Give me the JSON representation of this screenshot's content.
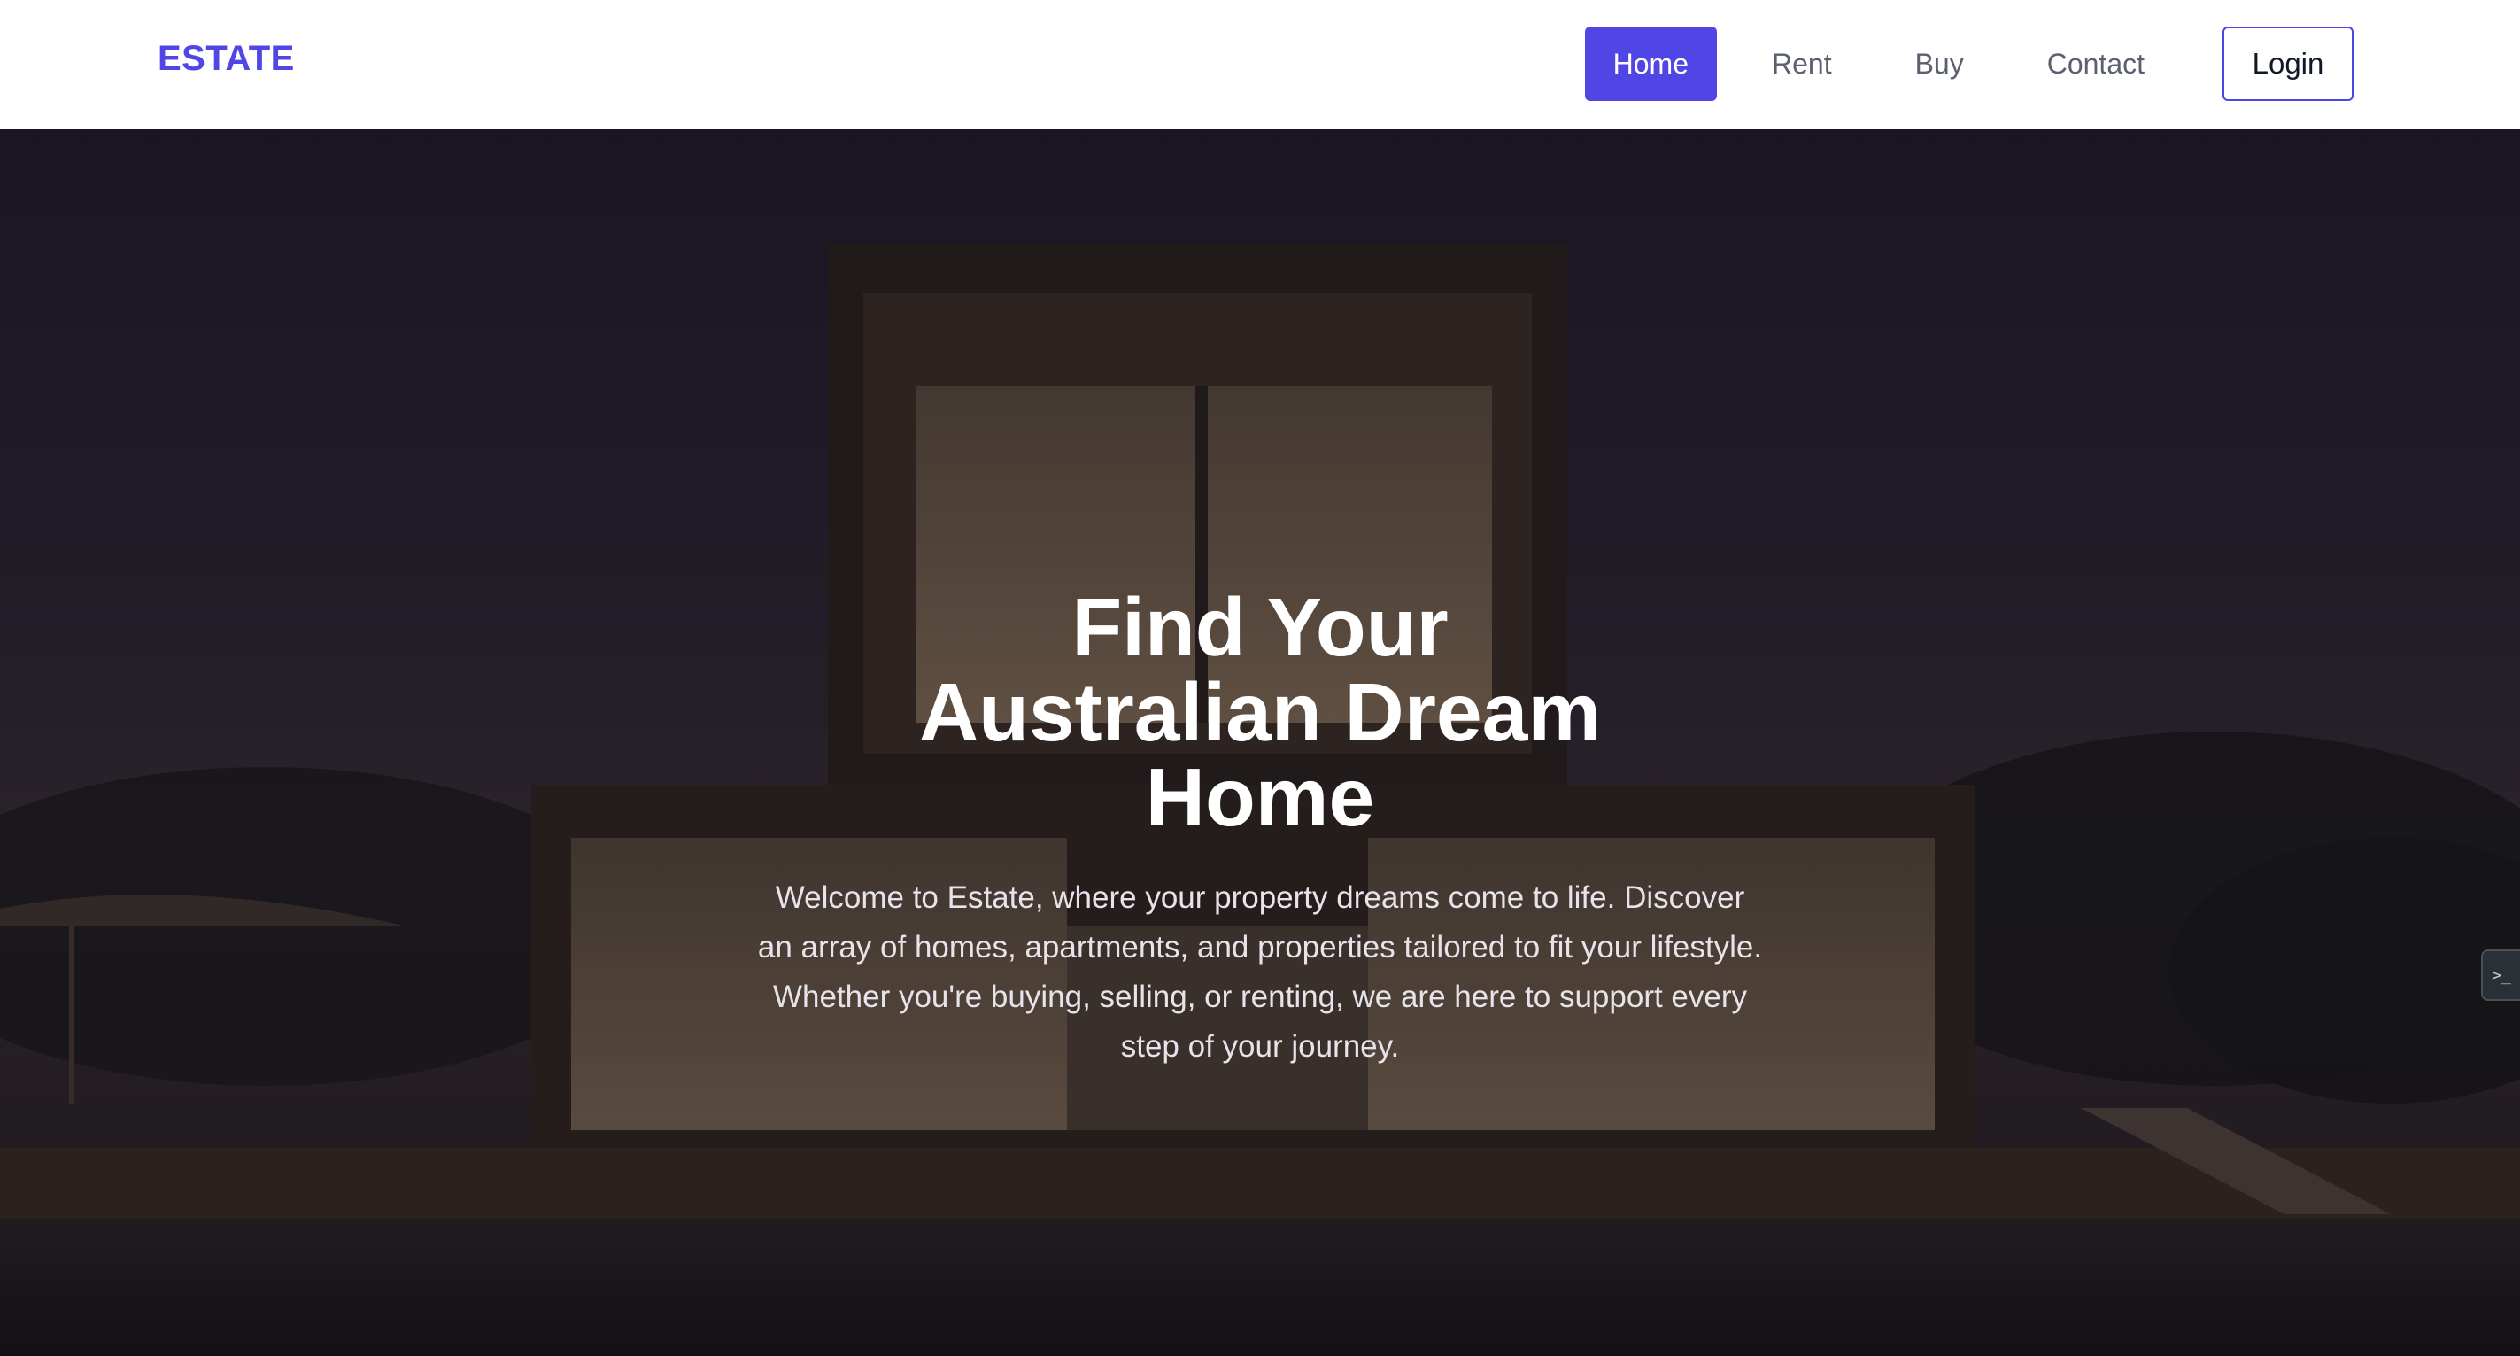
{
  "header": {
    "brand": "ESTATE",
    "nav": [
      {
        "label": "Home",
        "active": true
      },
      {
        "label": "Rent",
        "active": false
      },
      {
        "label": "Buy",
        "active": false
      },
      {
        "label": "Contact",
        "active": false
      }
    ],
    "login_label": "Login"
  },
  "hero": {
    "title": "Find Your Australian Dream Home",
    "description": "Welcome to Estate, where your property dreams come to life. Discover an array of homes, apartments, and properties tailored to fit your lifestyle. Whether you're buying, selling, or renting, we are here to support every step of your journey."
  },
  "dev_tab": {
    "glyph": ">_"
  },
  "colors": {
    "accent": "#4f46e5",
    "header_bg": "#ffffff",
    "hero_text": "#ffffff"
  }
}
